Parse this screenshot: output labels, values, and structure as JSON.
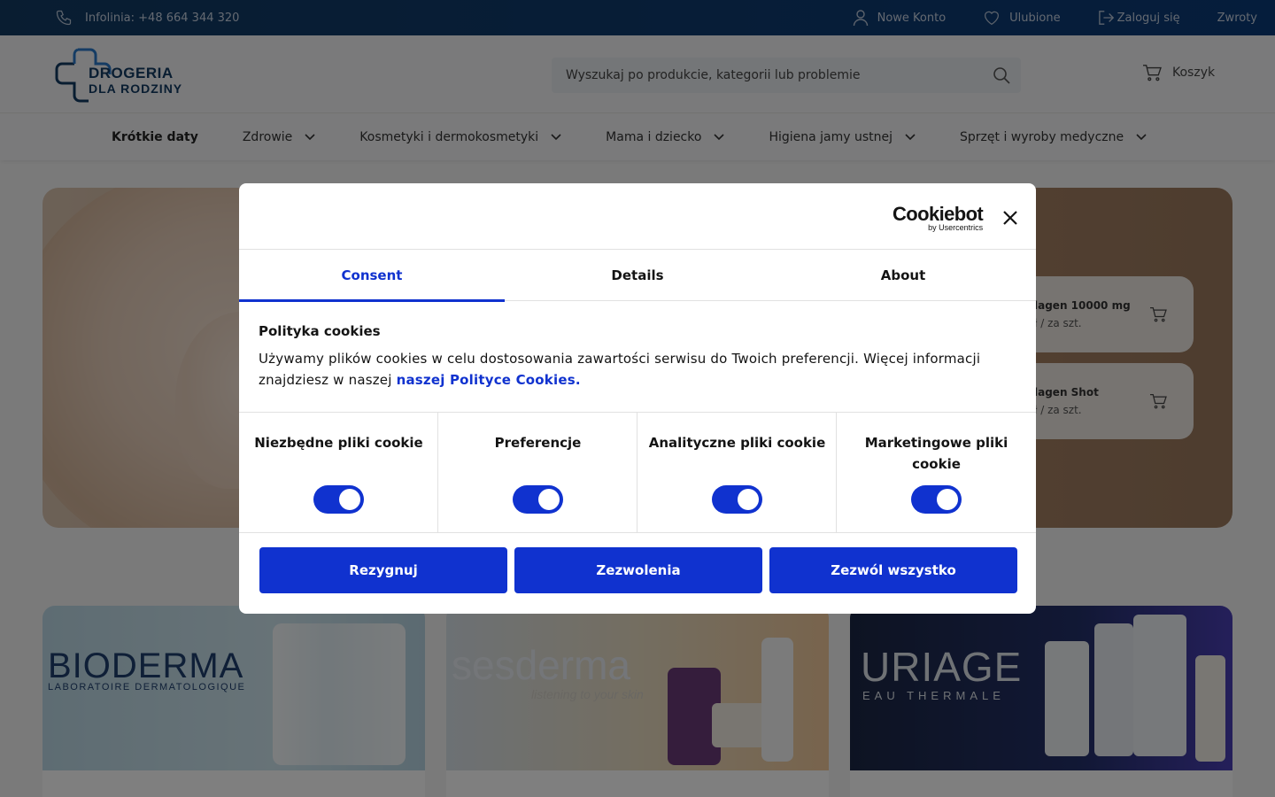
{
  "topbar": {
    "infoline": "Infolinia: +48 664 344 320",
    "links": [
      {
        "label": "Nowe Konto",
        "icon": "user-icon"
      },
      {
        "label": "Ulubione",
        "icon": "heart-icon"
      },
      {
        "label": "Zaloguj się",
        "icon": "login-icon"
      },
      {
        "label": "Zwroty",
        "icon": ""
      }
    ]
  },
  "header": {
    "logo_line1": "DROGERIA",
    "logo_line2": "DLA RODZINY",
    "search_placeholder": "Wyszukaj po produkcie, kategorii lub problemie",
    "cart_label": "Koszyk"
  },
  "nav": {
    "items": [
      {
        "label": "Krótkie daty"
      },
      {
        "label": "Zdrowie"
      },
      {
        "label": "Kosmetyki i dermokosmetyki"
      },
      {
        "label": "Mama i dziecko"
      },
      {
        "label": "Higiena jamy ustnej"
      },
      {
        "label": "Sprzęt i wyroby medyczne"
      }
    ]
  },
  "hero": {
    "products": [
      {
        "name": "lagen 10000 mg",
        "price": "ł / za szt."
      },
      {
        "name": "lagen Shot",
        "price": "ł / za szt."
      }
    ]
  },
  "brands": [
    {
      "name": "BIODERMA",
      "sub": "LABORATOIRE DERMATOLOGIQUE"
    },
    {
      "name": "sesderma",
      "sub": "listening to your skin"
    },
    {
      "name": "URIAGE",
      "sub": "EAU THERMALE"
    }
  ],
  "cookie": {
    "logo_main": "Cookiebot",
    "logo_sub": "by Usercentrics",
    "tabs": [
      "Consent",
      "Details",
      "About"
    ],
    "active_tab": "Consent",
    "heading": "Polityka cookies",
    "text": "Używamy plików cookies w celu dostosowania zawartości serwisu do Twoich preferencji. Więcej informacji znajdziesz w naszej ",
    "link": "naszej Polityce Cookies.",
    "toggles": [
      {
        "label": "Niezbędne pliki cookie",
        "on": true
      },
      {
        "label": "Preferencje",
        "on": true
      },
      {
        "label": "Analityczne pliki cookie",
        "on": true
      },
      {
        "label": "Marketingowe pliki cookie",
        "on": true
      }
    ],
    "buttons": {
      "decline": "Rezygnuj",
      "allow_selection": "Zezwolenia",
      "allow_all": "Zezwól wszystko"
    }
  },
  "colors": {
    "accent": "#1032cf",
    "topbar": "#123a63"
  }
}
